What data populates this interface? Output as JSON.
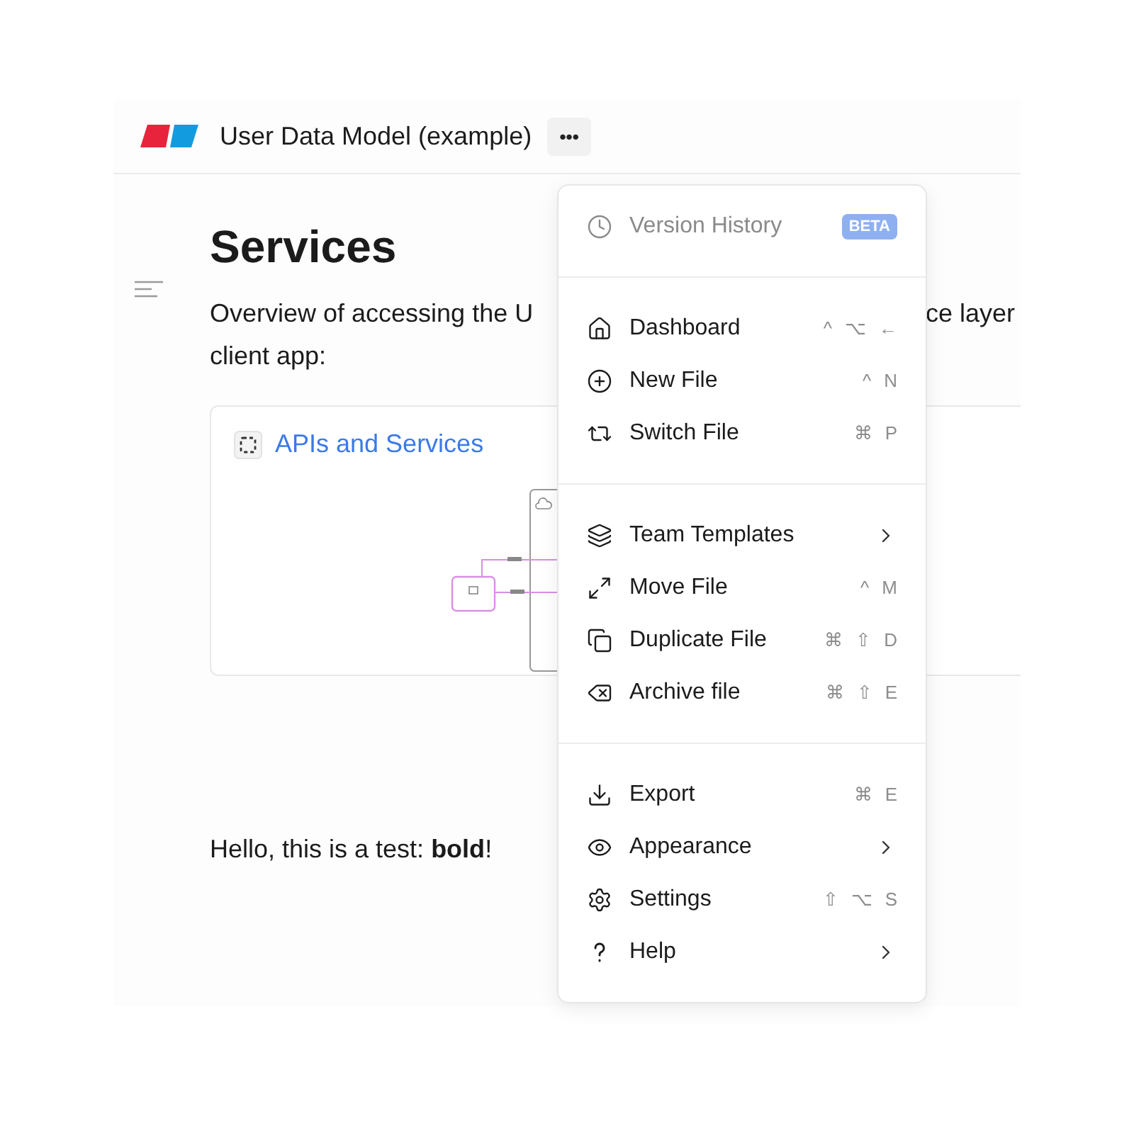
{
  "header": {
    "title": "User Data Model (example)",
    "more_button": "•••"
  },
  "document": {
    "heading": "Services",
    "paragraph": {
      "line_1_start": "Overview of accessing the U",
      "line_1_end": "ce layer",
      "line_2": "client app:"
    },
    "card": {
      "link": "APIs and Services"
    },
    "text": "Hello, this is a test: **bold**!"
  },
  "menu": {
    "sections": [
      [
        {
          "label": "Version History",
          "badge": "BETA",
          "disabled": true
        }
      ],
      [
        {
          "label": "Dashboard",
          "shortcut": [
            "^",
            "⌥",
            "←"
          ],
          "disabled": false
        },
        {
          "label": "New File",
          "shortcut": [
            "^",
            "N"
          ],
          "disabled": false
        },
        {
          "label": "Switch File",
          "shortcut": [
            "⌘",
            "P"
          ],
          "disabled": false
        }
      ],
      [
        {
          "label": "Team Templates",
          "submenu": true,
          "disabled": false
        },
        {
          "label": "Move File",
          "shortcut": [
            "^",
            "M"
          ],
          "disabled": false
        },
        {
          "label": "Duplicate File",
          "shortcut": [
            "⌘",
            "⇧",
            "D"
          ],
          "disabled": false
        },
        {
          "label": "Archive file",
          "shortcut": [
            "⌘",
            "⇧",
            "E"
          ],
          "disabled": false
        }
      ],
      [
        {
          "label": "Export",
          "shortcut": [
            "⌘",
            "E"
          ],
          "disabled": false
        },
        {
          "label": "Appearance",
          "submenu": true,
          "disabled": false
        },
        {
          "label": "Settings",
          "shortcut": [
            "⇧",
            "⌥",
            "S"
          ],
          "disabled": false
        },
        {
          "label": "Help",
          "submenu": true,
          "disabled": false
        }
      ]
    ]
  }
}
